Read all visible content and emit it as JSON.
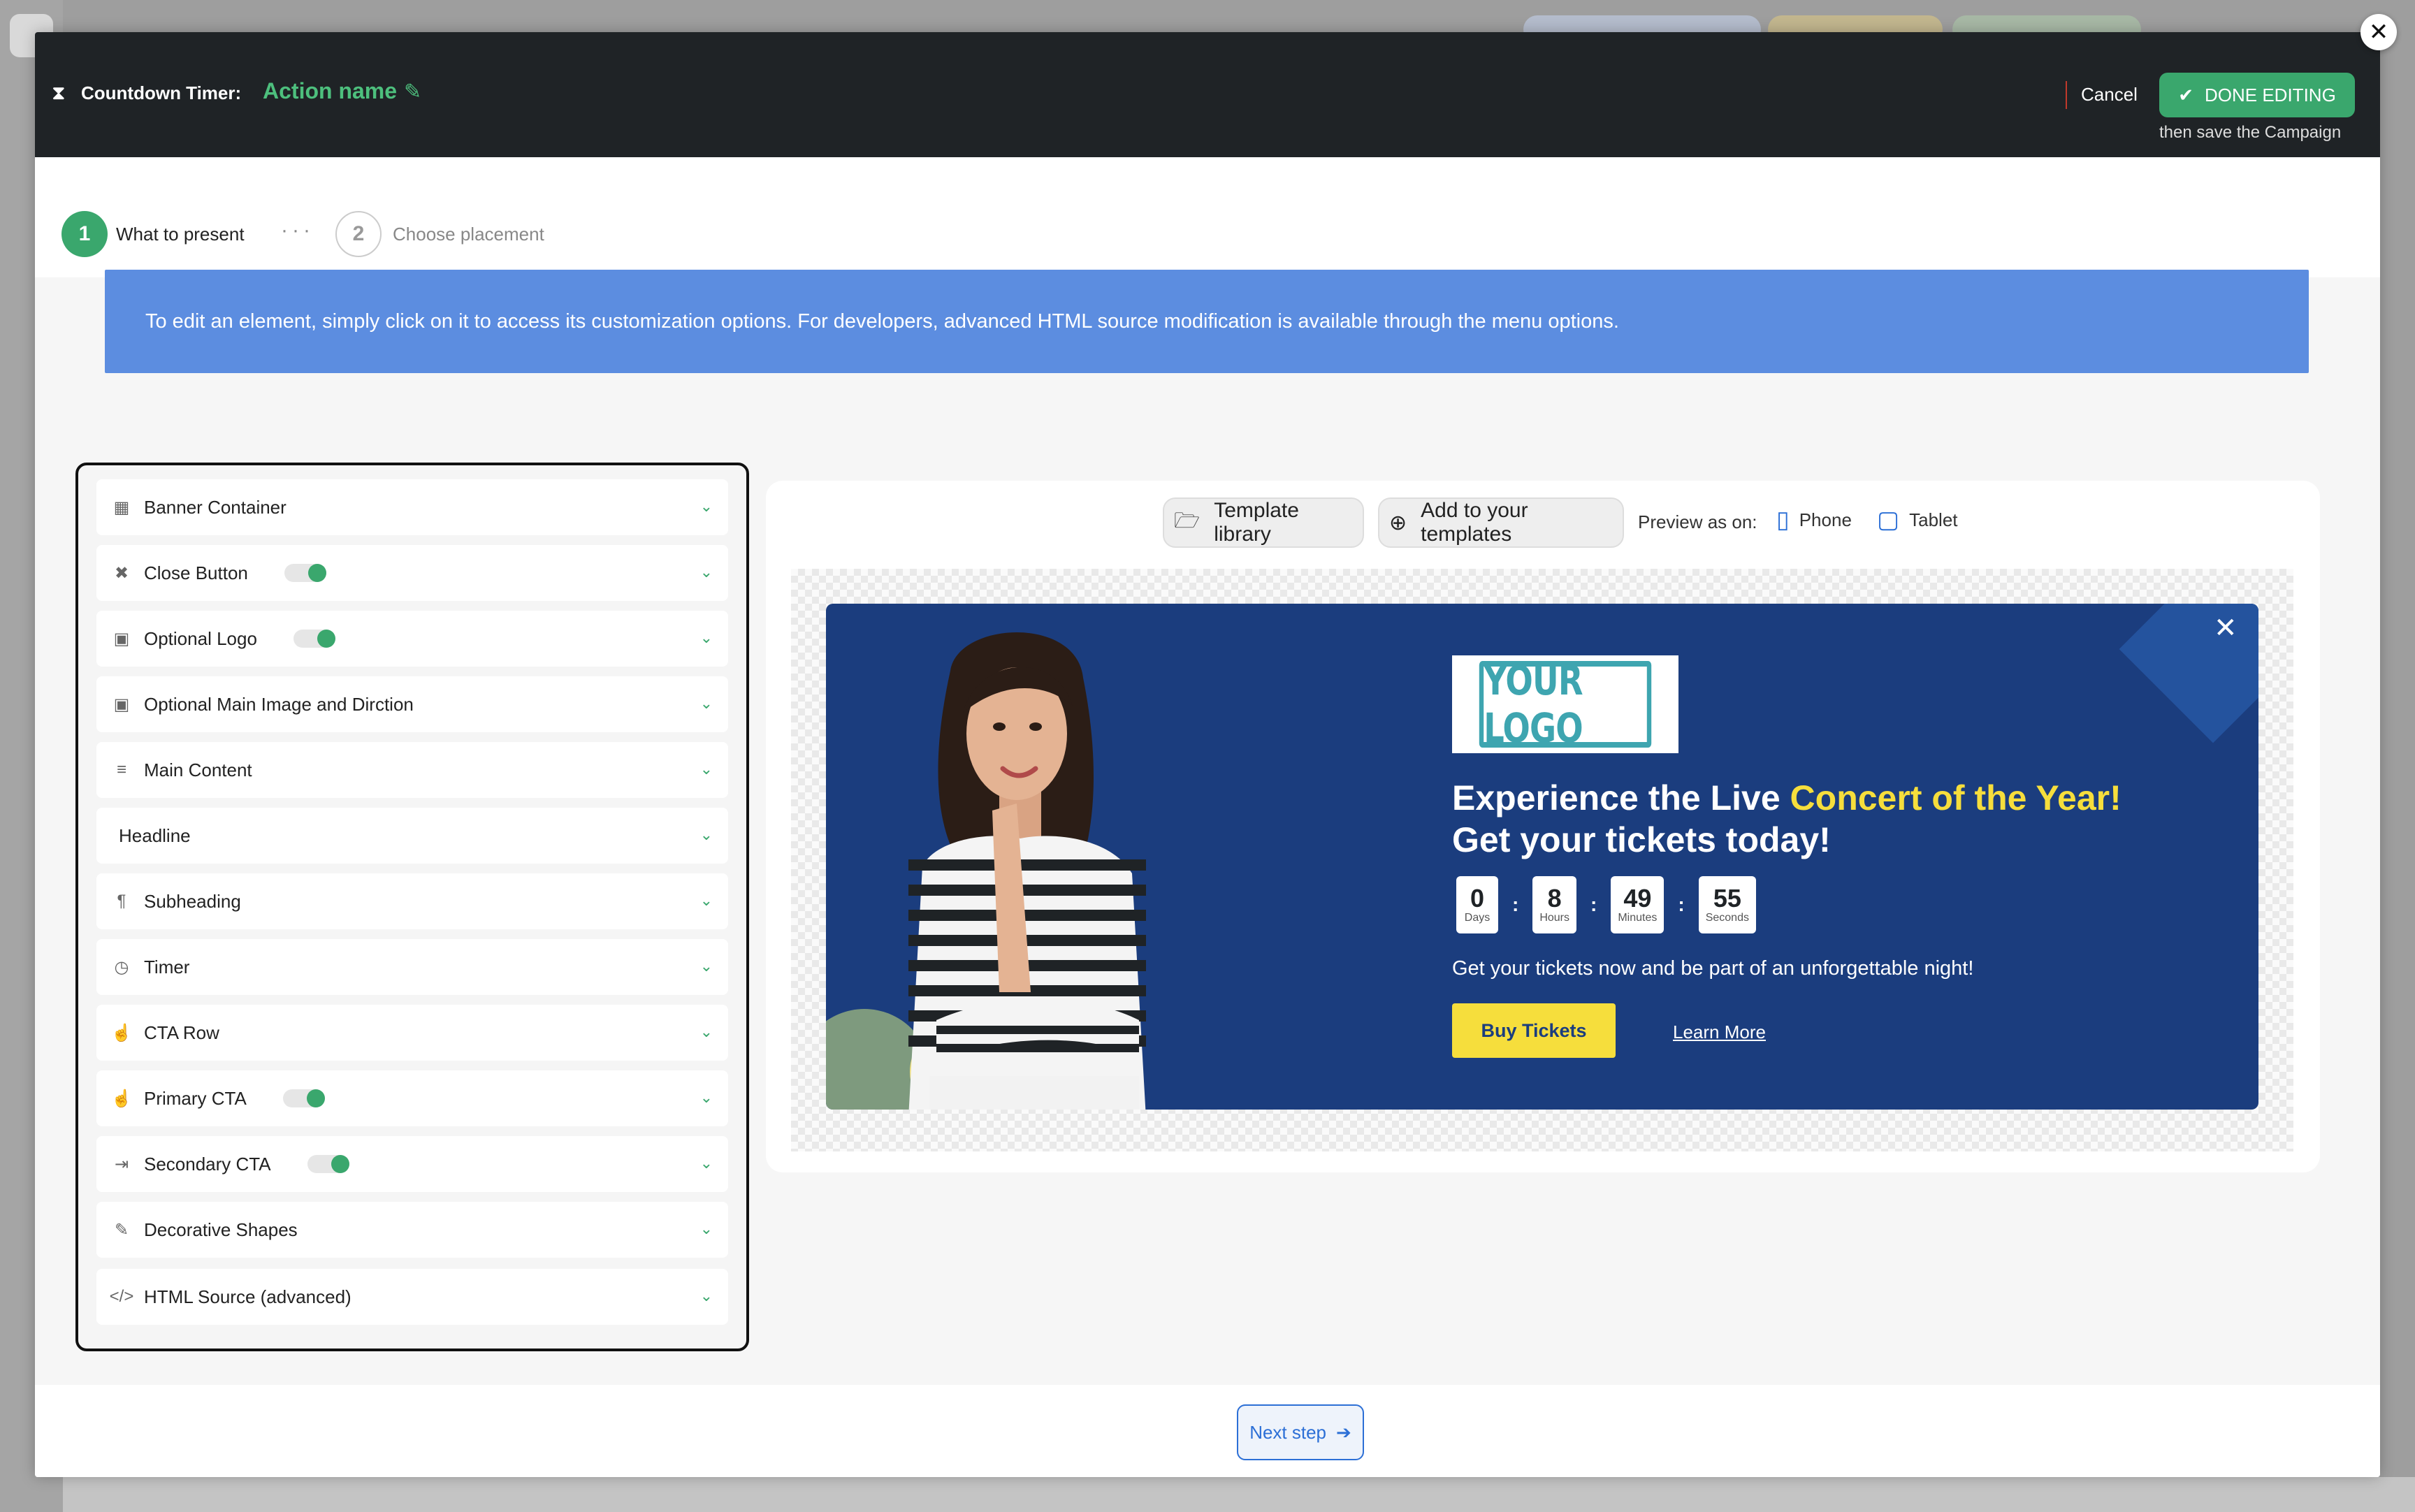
{
  "header": {
    "title_label": "Countdown Timer:",
    "action_name": "Action name",
    "cancel_label": "Cancel",
    "done_label": "DONE EDITING",
    "done_sub": "then save the Campaign"
  },
  "stepper": {
    "steps": [
      {
        "number": "1",
        "label": "What to present"
      },
      {
        "number": "2",
        "label": "Choose placement"
      }
    ],
    "separator": "···"
  },
  "info_banner": "To edit an element, simply click on it to access its customization options. For developers, advanced HTML source modification is available through the menu options.",
  "elements_panel": {
    "items": [
      {
        "label": "Banner Container",
        "icon": "grid-icon",
        "toggle": false
      },
      {
        "label": "Close Button",
        "icon": "close-icon",
        "toggle": true
      },
      {
        "label": "Optional Logo",
        "icon": "image-icon",
        "toggle": true
      },
      {
        "label": "Optional Main Image and Dirction",
        "icon": "image-icon",
        "toggle": false
      },
      {
        "label": "Main Content",
        "icon": "lines-icon",
        "toggle": false
      },
      {
        "label": "Headline",
        "icon": "",
        "toggle": false
      },
      {
        "label": "Subheading",
        "icon": "paragraph-icon",
        "toggle": false
      },
      {
        "label": "Timer",
        "icon": "clock-icon",
        "toggle": false
      },
      {
        "label": "CTA Row",
        "icon": "pointer-icon",
        "toggle": false
      },
      {
        "label": "Primary CTA",
        "icon": "pointer-icon",
        "toggle": true
      },
      {
        "label": "Secondary CTA",
        "icon": "enter-icon",
        "toggle": true
      },
      {
        "label": "Decorative Shapes",
        "icon": "brush-icon",
        "toggle": false
      },
      {
        "label": "HTML Source (advanced)",
        "icon": "code-icon",
        "toggle": false
      }
    ]
  },
  "preview_toolbar": {
    "template_library": "Template library",
    "add_templates": "Add to your templates",
    "preview_as": "Preview as on:",
    "phone": "Phone",
    "tablet": "Tablet"
  },
  "banner": {
    "logo_text": "YOUR LOGO",
    "headline_part1": "Experience the Live ",
    "headline_highlight": "Concert of the Year!",
    "headline_line2": "Get your tickets today!",
    "timer": [
      {
        "value": "0",
        "unit": "Days"
      },
      {
        "value": "8",
        "unit": "Hours"
      },
      {
        "value": "49",
        "unit": "Minutes"
      },
      {
        "value": "55",
        "unit": "Seconds"
      }
    ],
    "timer_separator": ":",
    "subheading": "Get your tickets now and be part of an unforgettable night!",
    "primary_cta": "Buy Tickets",
    "secondary_cta": "Learn More",
    "colors": {
      "background": "#1b3d7e",
      "accent": "#f6de3c"
    }
  },
  "footer": {
    "next_label": "Next step"
  },
  "colors": {
    "accent_green": "#3aa76d",
    "info_blue": "#5c8de0",
    "link_blue": "#2c6fd6"
  }
}
